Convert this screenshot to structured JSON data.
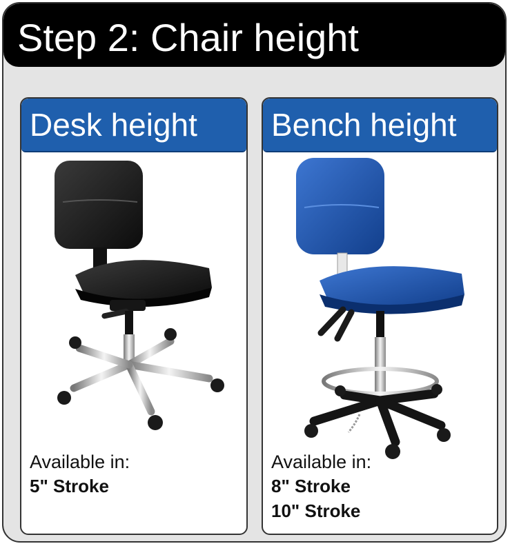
{
  "page": {
    "title": "Step 2: Chair height"
  },
  "options": [
    {
      "title": "Desk height",
      "chair_color": "#1b1b1b",
      "available_label": "Available in:",
      "strokes": [
        "5\" Stroke"
      ]
    },
    {
      "title": "Bench height",
      "chair_color": "#1d4fa6",
      "available_label": "Available in:",
      "strokes": [
        "8\" Stroke",
        "10\" Stroke"
      ]
    }
  ],
  "colors": {
    "header_bg": "#000000",
    "card_head_bg": "#1f5fad",
    "panel_bg": "#e4e4e4"
  },
  "icons": [
    "desk-chair-image",
    "bench-chair-image"
  ]
}
